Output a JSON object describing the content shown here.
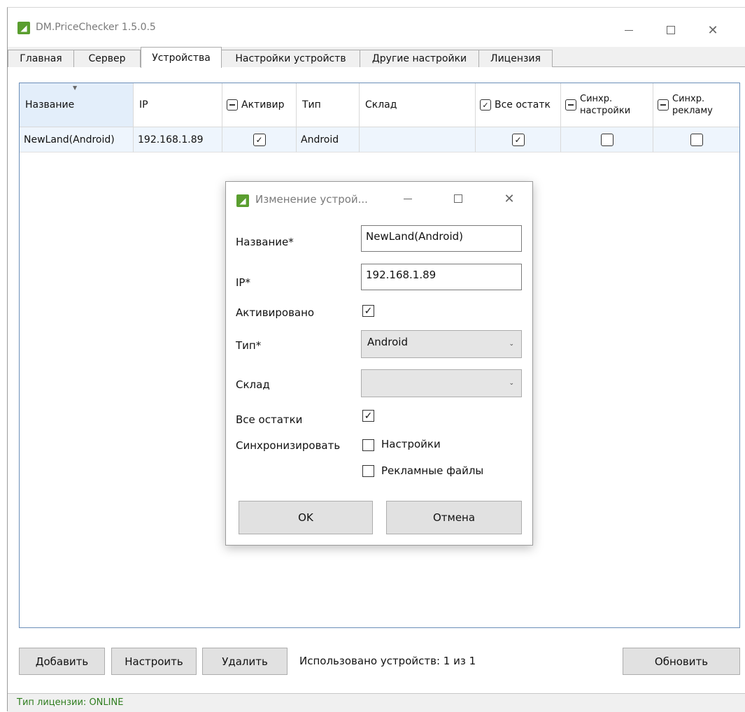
{
  "window": {
    "title": "DM.PriceChecker 1.5.0.5",
    "logo_icon": "app-logo-icon"
  },
  "tabs": [
    {
      "label": "Главная"
    },
    {
      "label": "Сервер"
    },
    {
      "label": "Устройства",
      "active": true
    },
    {
      "label": "Настройки устройств"
    },
    {
      "label": "Другие настройки"
    },
    {
      "label": "Лицензия"
    }
  ],
  "grid": {
    "columns": [
      {
        "label": "Название"
      },
      {
        "label": "IP"
      },
      {
        "label": "Активир",
        "header_checkbox": "indeterminate"
      },
      {
        "label": "Тип"
      },
      {
        "label": "Склад"
      },
      {
        "label": "Все остатк",
        "header_checkbox": "checked"
      },
      {
        "label": "Синхр.",
        "label2": "настройки",
        "header_checkbox": "indeterminate"
      },
      {
        "label": "Синхр.",
        "label2": "рекламу",
        "header_checkbox": "indeterminate"
      }
    ],
    "rows": [
      {
        "name": "NewLand(Android)",
        "ip": "192.168.1.89",
        "active": true,
        "type": "Android",
        "warehouse": "",
        "all_stock": true,
        "sync_settings": false,
        "sync_ads": false
      }
    ]
  },
  "buttons": {
    "add": "Добавить",
    "configure": "Настроить",
    "delete": "Удалить",
    "refresh": "Обновить"
  },
  "usage_text": "Использовано устройств: 1 из 1",
  "status": {
    "license": "Тип лицензии: ONLINE",
    "color": "#2e7d1e"
  },
  "dialog": {
    "title": "Изменение устрой...",
    "name_label": "Название*",
    "name_value": "NewLand(Android)",
    "ip_label": "IP*",
    "ip_value": "192.168.1.89",
    "active_label": "Активировано",
    "active_checked": true,
    "type_label": "Тип*",
    "type_value": "Android",
    "warehouse_label": "Склад",
    "warehouse_value": "",
    "all_stock_label": "Все остатки",
    "all_stock_checked": true,
    "sync_label": "Синхронизировать",
    "sync_settings_label": "Настройки",
    "sync_settings_checked": false,
    "sync_ads_label": "Рекламные файлы",
    "sync_ads_checked": false,
    "ok": "OK",
    "cancel": "Отмена"
  },
  "colors": {
    "accent_border": "#6a8eb8",
    "selected_row": "#eef5fd",
    "app_logo": "#5a9e2f"
  }
}
